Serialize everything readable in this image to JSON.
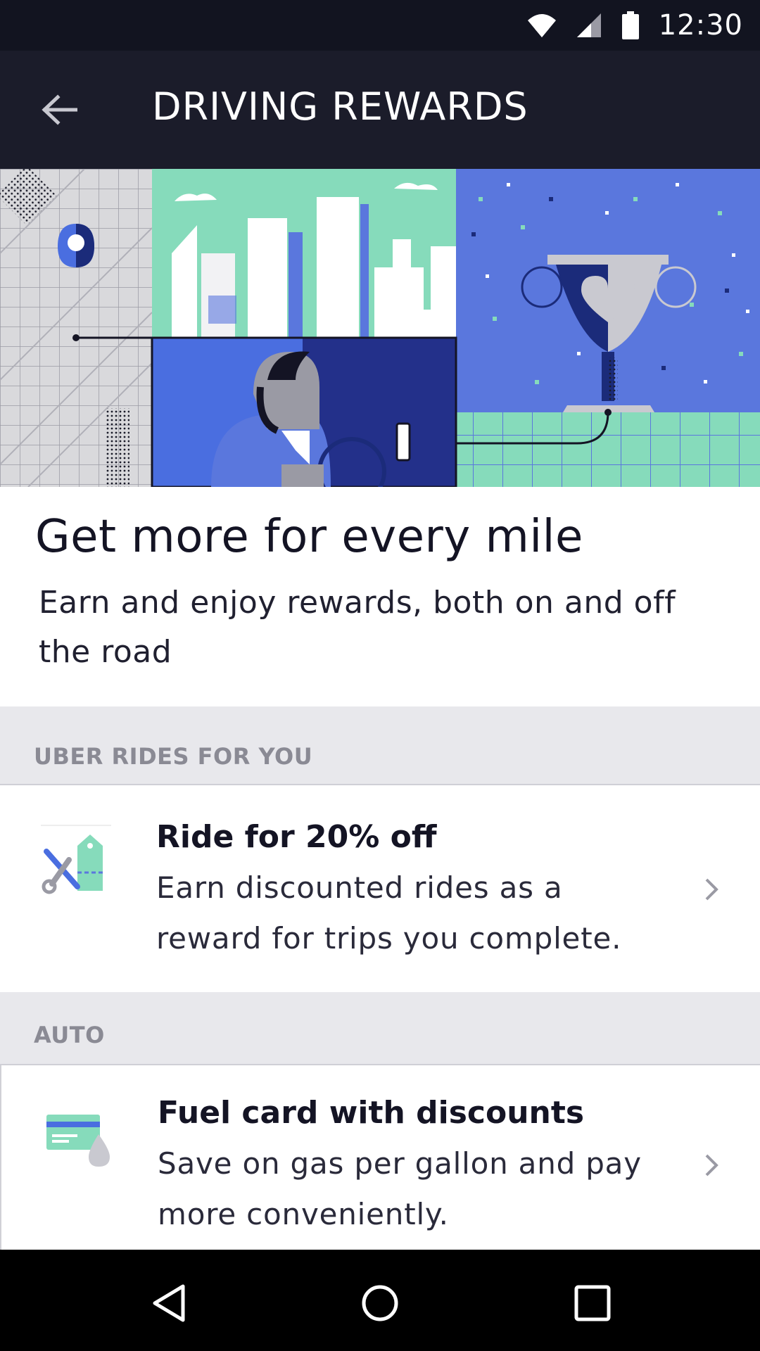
{
  "status_bar": {
    "time": "12:30",
    "icons": [
      "wifi-icon",
      "signal-icon",
      "battery-icon"
    ]
  },
  "app_bar": {
    "title": "DRIVING REWARDS",
    "back_icon": "arrow-left-icon"
  },
  "intro": {
    "title": "Get more for every mile",
    "subtitle": "Earn and enjoy rewards, both on and off the road"
  },
  "sections": [
    {
      "header": "UBER RIDES FOR YOU",
      "items": [
        {
          "title": "Ride for 20% off",
          "description": "Earn discounted rides as a reward for trips you complete.",
          "icon": "discount-tag-icon"
        }
      ]
    },
    {
      "header": "AUTO",
      "items": [
        {
          "title": "Fuel card with discounts",
          "description": "Save on gas per gallon and pay more conveniently.",
          "icon": "fuel-card-icon"
        }
      ]
    }
  ],
  "nav_bar": {
    "buttons": [
      "back-triangle-icon",
      "home-circle-icon",
      "recents-square-icon"
    ]
  },
  "colors": {
    "status_bar_bg": "#121420",
    "app_bar_bg": "#1b1c2a",
    "mint": "#86dbbb",
    "blue": "#5a77dd",
    "navy": "#23308a",
    "section_bg": "#e8e8ec"
  }
}
